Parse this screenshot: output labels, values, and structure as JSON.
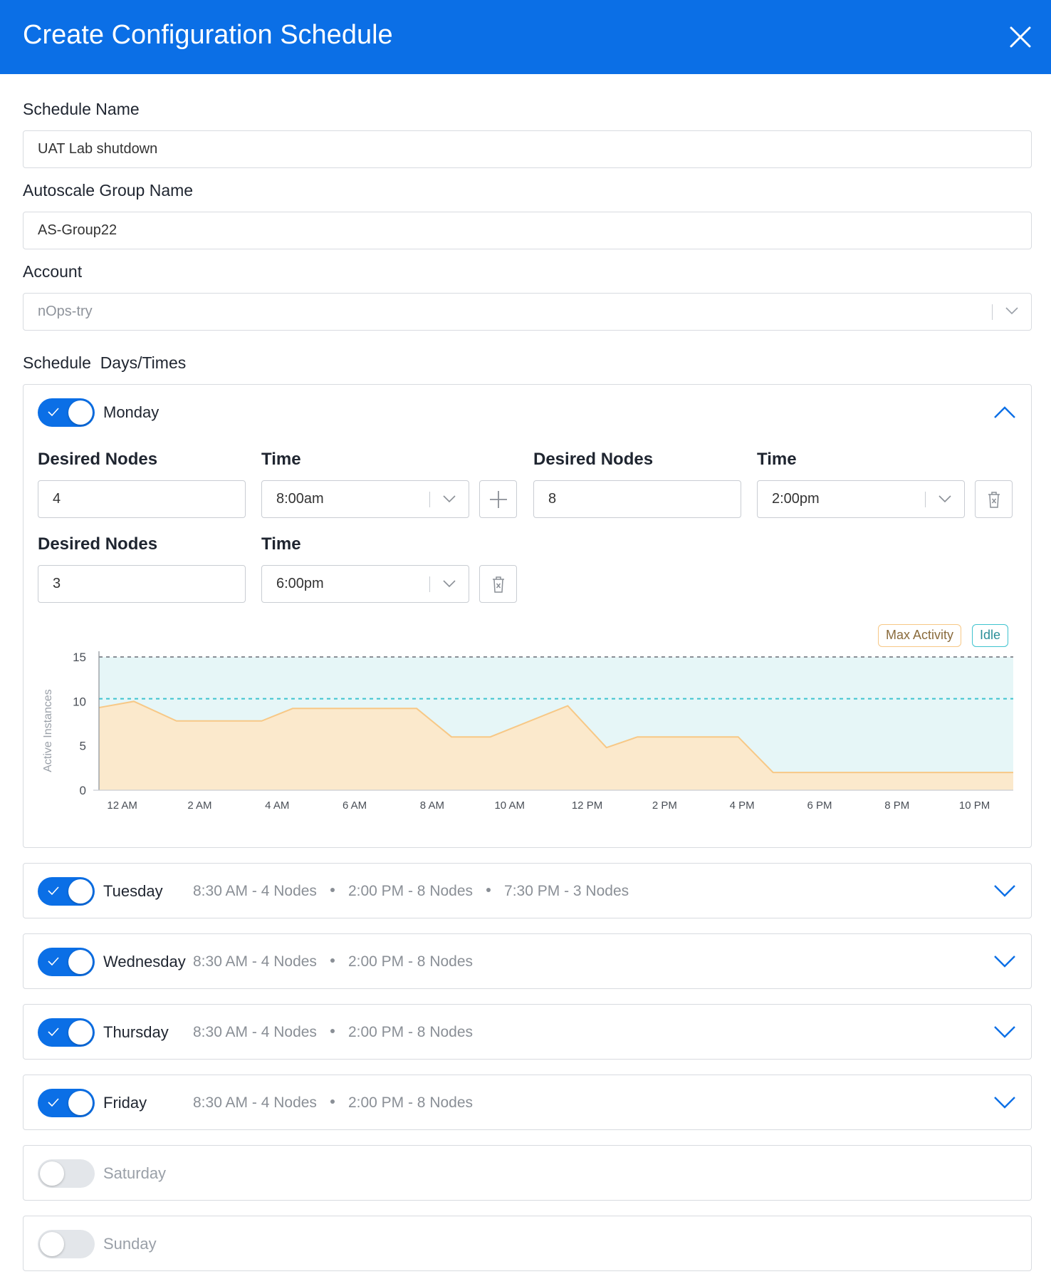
{
  "header": {
    "title": "Create Configuration Schedule"
  },
  "form": {
    "schedule_name": {
      "label": "Schedule Name",
      "value": "UAT Lab shutdown"
    },
    "autoscale_group": {
      "label": "Autoscale Group Name",
      "value": "AS-Group22"
    },
    "account": {
      "label": "Account",
      "value": "nOps-try"
    },
    "schedule_label": "Schedule  Days/Times"
  },
  "monday": {
    "name": "Monday",
    "enabled": true,
    "expanded": true,
    "desired_nodes_label": "Desired Nodes",
    "time_label": "Time",
    "entries": [
      {
        "nodes": "4",
        "time": "8:00am"
      },
      {
        "nodes": "8",
        "time": "2:00pm"
      },
      {
        "nodes": "3",
        "time": "6:00pm"
      }
    ]
  },
  "days": [
    {
      "name": "Tuesday",
      "enabled": true,
      "summary": [
        "8:30 AM - 4 Nodes",
        "2:00 PM - 8 Nodes",
        "7:30 PM - 3 Nodes"
      ]
    },
    {
      "name": "Wednesday",
      "enabled": true,
      "summary": [
        "8:30 AM - 4 Nodes",
        "2:00 PM - 8 Nodes"
      ]
    },
    {
      "name": "Thursday",
      "enabled": true,
      "summary": [
        "8:30 AM - 4 Nodes",
        "2:00 PM - 8 Nodes"
      ]
    },
    {
      "name": "Friday",
      "enabled": true,
      "summary": [
        "8:30 AM - 4 Nodes",
        "2:00 PM - 8 Nodes"
      ]
    },
    {
      "name": "Saturday",
      "enabled": false,
      "summary": []
    },
    {
      "name": "Sunday",
      "enabled": false,
      "summary": []
    }
  ],
  "colors": {
    "primary": "#0b6fe6",
    "max_activity_fill": "#fbe9cc",
    "max_activity_line": "#f7c886",
    "idle_fill": "#e6f6f7",
    "idle_line": "#3ec3cf"
  },
  "chart_data": {
    "type": "area",
    "ylabel": "Active Instances",
    "xlabel": "",
    "ylim": [
      0,
      15
    ],
    "y_ticks": [
      0,
      5,
      10,
      15
    ],
    "x_range": [
      -0.6,
      23
    ],
    "x_ticks": [
      {
        "x": 0,
        "label": "12 AM"
      },
      {
        "x": 2,
        "label": "2 AM"
      },
      {
        "x": 4,
        "label": "4 AM"
      },
      {
        "x": 6,
        "label": "6 AM"
      },
      {
        "x": 8,
        "label": "8 AM"
      },
      {
        "x": 10,
        "label": "10 AM"
      },
      {
        "x": 12,
        "label": "12 PM"
      },
      {
        "x": 14,
        "label": "2 PM"
      },
      {
        "x": 16,
        "label": "4 PM"
      },
      {
        "x": 18,
        "label": "6 PM"
      },
      {
        "x": 20,
        "label": "8 PM"
      },
      {
        "x": 22,
        "label": "10 PM"
      }
    ],
    "legend": [
      "Max Activity",
      "Idle"
    ],
    "legend_position": "top-right",
    "grid": false,
    "series": [
      {
        "name": "Max Activity",
        "x": [
          -0.6,
          0.3,
          1.4,
          3.6,
          4.4,
          7.6,
          8.5,
          9.5,
          11.5,
          12.5,
          13.3,
          15.9,
          16.8,
          23
        ],
        "y": [
          9.3,
          10.0,
          7.8,
          7.8,
          9.2,
          9.2,
          6.0,
          6.0,
          9.5,
          4.8,
          6.0,
          6.0,
          2.0,
          2.0
        ]
      },
      {
        "name": "Idle",
        "y_lines": [
          10.3,
          15
        ]
      }
    ]
  }
}
